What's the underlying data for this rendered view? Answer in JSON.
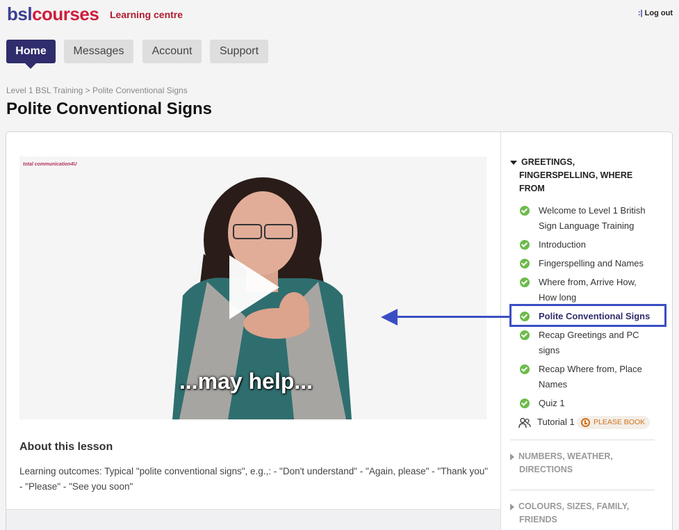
{
  "header": {
    "logo_bsl": "bsl",
    "logo_courses": "courses",
    "logo_sub": "Learning centre",
    "top_sep": ":|",
    "logout": "Log out"
  },
  "nav": {
    "tabs": [
      {
        "label": "Home",
        "active": true
      },
      {
        "label": "Messages"
      },
      {
        "label": "Account"
      },
      {
        "label": "Support"
      }
    ]
  },
  "breadcrumb": "Level 1 BSL Training > Polite Conventional Signs",
  "page_title": "Polite Conventional Signs",
  "video": {
    "brand": "total communication4U",
    "caption": "...may help..."
  },
  "about": {
    "title": "About this lesson",
    "text": "Learning outcomes: Typical \"polite conventional signs\", e.g.,: - \"Don't understand\" - \"Again, please\" - \"Thank you\" - \"Please\" - \"See you soon\""
  },
  "sidebar": {
    "sections": [
      {
        "title": "GREETINGS, FINGERSPELLING, WHERE FROM",
        "expanded": true,
        "lessons": [
          {
            "label": "Welcome to Level 1 British Sign Language Training"
          },
          {
            "label": "Introduction"
          },
          {
            "label": "Fingerspelling and Names"
          },
          {
            "label": "Where from, Arrive How, How long"
          },
          {
            "label": "Polite Conventional Signs",
            "active": true
          },
          {
            "label": "Recap Greetings and PC signs"
          },
          {
            "label": "Recap Where from, Place Names"
          },
          {
            "label": "Quiz 1"
          }
        ],
        "tutorial": {
          "label": "Tutorial 1",
          "badge": "PLEASE BOOK"
        }
      },
      {
        "title": "NUMBERS, WEATHER, DIRECTIONS",
        "expanded": false
      },
      {
        "title": "COLOURS, SIZES, FAMILY, FRIENDS",
        "expanded": false
      }
    ]
  },
  "colors": {
    "brand_blue": "#3b3f94",
    "brand_red": "#cc1f3d",
    "nav_active": "#2f2d6b",
    "check_green": "#6dbb4a",
    "annotation_blue": "#3a4ec4",
    "badge_orange": "#d27219"
  }
}
